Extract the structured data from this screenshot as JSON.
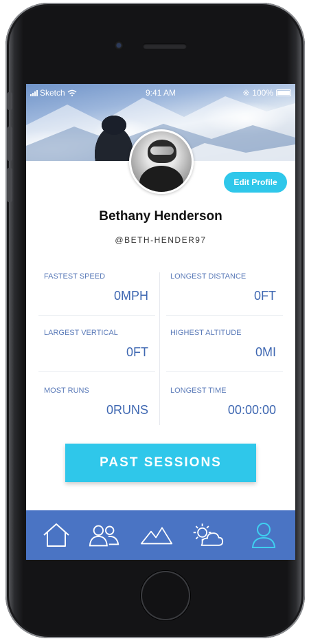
{
  "status_bar": {
    "carrier": "Sketch",
    "time": "9:41 AM",
    "battery": "100%"
  },
  "profile": {
    "name": "Bethany Henderson",
    "handle": "@BETH-HENDER97",
    "edit_label": "Edit Profile"
  },
  "stats": [
    {
      "label": "FASTEST SPEED",
      "value": "0MPH"
    },
    {
      "label": "LONGEST DISTANCE",
      "value": "0FT"
    },
    {
      "label": "LARGEST VERTICAL",
      "value": "0FT"
    },
    {
      "label": "HIGHEST ALTITUDE",
      "value": "0MI"
    },
    {
      "label": "MOST RUNS",
      "value": "0RUNS"
    },
    {
      "label": "LONGEST TIME",
      "value": "00:00:00"
    }
  ],
  "past_sessions_label": "PAST SESSIONS",
  "tabs": [
    {
      "icon": "home-icon",
      "active": false
    },
    {
      "icon": "friends-icon",
      "active": false
    },
    {
      "icon": "mountain-icon",
      "active": false
    },
    {
      "icon": "weather-icon",
      "active": false
    },
    {
      "icon": "profile-icon",
      "active": true
    }
  ],
  "colors": {
    "accent": "#2fc7ea",
    "tabbar": "#4a74c4",
    "stat_label": "#5a7ab8",
    "stat_value": "#3f68b2",
    "active_tab_icon": "#3fd0f0"
  }
}
